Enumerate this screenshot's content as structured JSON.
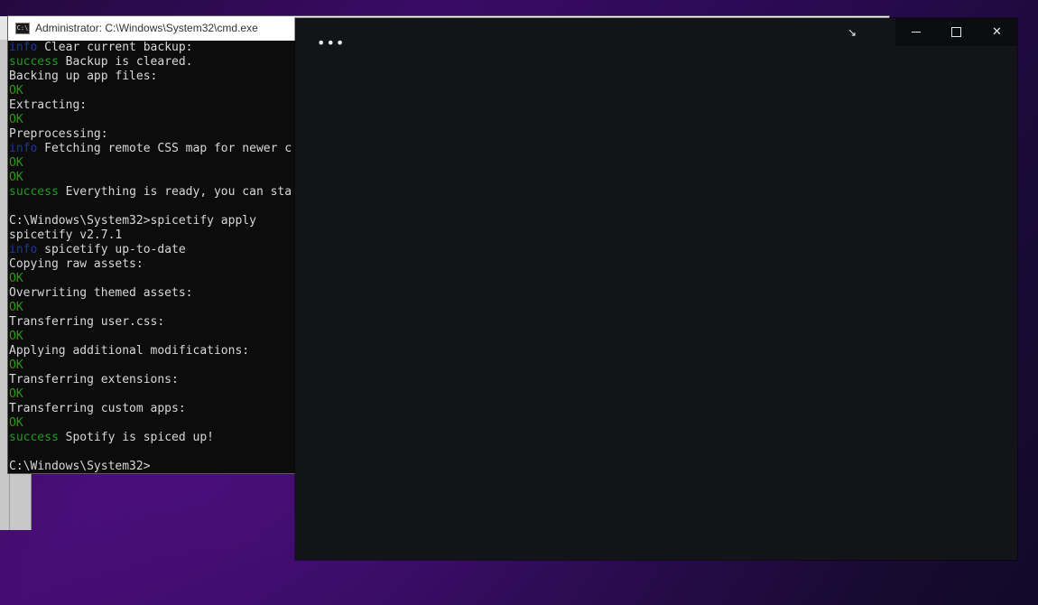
{
  "cmd_window": {
    "title": "Administrator: C:\\Windows\\System32\\cmd.exe",
    "icon_label": "C:\\",
    "lines": [
      {
        "tag": "info",
        "tag_text": "info",
        "text": " Clear current backup:"
      },
      {
        "tag": "success",
        "tag_text": "success",
        "text": " Backup is cleared."
      },
      {
        "tag": "",
        "tag_text": "",
        "text": "Backing up app files:"
      },
      {
        "tag": "ok",
        "tag_text": "OK",
        "text": ""
      },
      {
        "tag": "",
        "tag_text": "",
        "text": "Extracting:"
      },
      {
        "tag": "ok",
        "tag_text": "OK",
        "text": ""
      },
      {
        "tag": "",
        "tag_text": "",
        "text": "Preprocessing:"
      },
      {
        "tag": "info",
        "tag_text": "info",
        "text": " Fetching remote CSS map for newer c"
      },
      {
        "tag": "ok",
        "tag_text": "OK",
        "text": ""
      },
      {
        "tag": "ok",
        "tag_text": "OK",
        "text": ""
      },
      {
        "tag": "success",
        "tag_text": "success",
        "text": " Everything is ready, you can sta"
      },
      {
        "tag": "",
        "tag_text": "",
        "text": ""
      },
      {
        "tag": "",
        "tag_text": "",
        "text": "C:\\Windows\\System32>spicetify apply"
      },
      {
        "tag": "",
        "tag_text": "",
        "text": "spicetify v2.7.1"
      },
      {
        "tag": "info",
        "tag_text": "info",
        "text": " spicetify up-to-date"
      },
      {
        "tag": "",
        "tag_text": "",
        "text": "Copying raw assets:"
      },
      {
        "tag": "ok",
        "tag_text": "OK",
        "text": ""
      },
      {
        "tag": "",
        "tag_text": "",
        "text": "Overwriting themed assets:"
      },
      {
        "tag": "ok",
        "tag_text": "OK",
        "text": ""
      },
      {
        "tag": "",
        "tag_text": "",
        "text": "Transferring user.css:"
      },
      {
        "tag": "ok",
        "tag_text": "OK",
        "text": ""
      },
      {
        "tag": "",
        "tag_text": "",
        "text": "Applying additional modifications:"
      },
      {
        "tag": "ok",
        "tag_text": "OK",
        "text": ""
      },
      {
        "tag": "",
        "tag_text": "",
        "text": "Transferring extensions:"
      },
      {
        "tag": "ok",
        "tag_text": "OK",
        "text": ""
      },
      {
        "tag": "",
        "tag_text": "",
        "text": "Transferring custom apps:"
      },
      {
        "tag": "ok",
        "tag_text": "OK",
        "text": ""
      },
      {
        "tag": "success",
        "tag_text": "success",
        "text": " Spotify is spiced up!"
      },
      {
        "tag": "",
        "tag_text": "",
        "text": ""
      },
      {
        "tag": "",
        "tag_text": "",
        "text": "C:\\Windows\\System32>"
      }
    ]
  },
  "spotify_window": {
    "menu_label": "•••",
    "minimize_icon": "minimize-icon",
    "maximize_icon": "maximize-icon",
    "close_label": "✕"
  },
  "colors": {
    "info": "#1f2fb8",
    "success": "#19a019",
    "ok": "#13a10e",
    "spotify_bg": "#121418"
  }
}
